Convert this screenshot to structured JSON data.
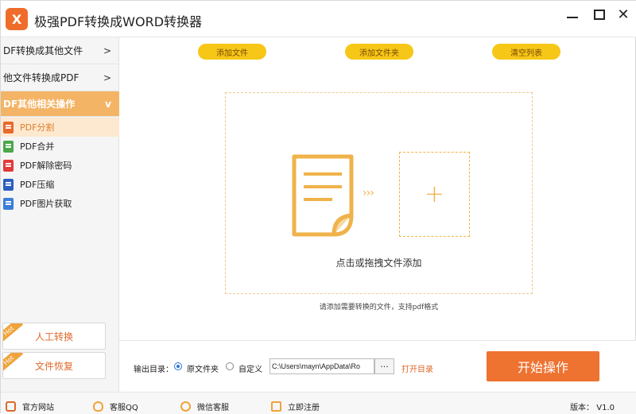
{
  "app": {
    "title": "极强PDF转换成WORD转换器",
    "logo": "X"
  },
  "colors": {
    "accent": "#ee7230",
    "yellow_btn": "#f7c718",
    "active_menu": "#f4b466",
    "dash": "#f0b24a"
  },
  "sidebar": {
    "menus": [
      {
        "label": "DF转换成其他文件",
        "arrow": ">"
      },
      {
        "label": "他文件转换成PDF",
        "arrow": ">"
      },
      {
        "label": "DF其他相关操作",
        "arrow": "v"
      }
    ],
    "sub_items": [
      {
        "label": "PDF分割",
        "icon": "pdf-split-icon",
        "color": "#e86a2c"
      },
      {
        "label": "PDF合并",
        "icon": "pdf-merge-icon",
        "color": "#4aa84a"
      },
      {
        "label": "PDF解除密码",
        "icon": "pdf-unlock-icon",
        "color": "#e23a3a"
      },
      {
        "label": "PDF压缩",
        "icon": "pdf-compress-icon",
        "color": "#2b5fbf"
      },
      {
        "label": "PDF图片获取",
        "icon": "pdf-image-icon",
        "color": "#3b7dd8"
      }
    ],
    "manual_label": "人工转换",
    "recover_label": "文件恢复",
    "hot_tag": "Hot"
  },
  "toolbar": {
    "add_file": "添加文件",
    "add_folder": "添加文件夹",
    "clear_list": "清空列表"
  },
  "dropzone": {
    "arrows": "›››",
    "plus": "+",
    "text": "点击或拖拽文件添加"
  },
  "hint": "请添加需要转换的文件，支持pdf格式",
  "output": {
    "label": "输出目录：",
    "option_original": "原文件夹",
    "option_custom": "自定义",
    "path": "C:\\Users\\mayn\\AppData\\Ro",
    "browse": "···",
    "open_dir": "打开目录"
  },
  "start_label": "开始操作",
  "footer": {
    "website": "官方网站",
    "qq": "客服QQ",
    "wechat": "微信客服",
    "register": "立即注册",
    "version": "版本： V1.0"
  }
}
